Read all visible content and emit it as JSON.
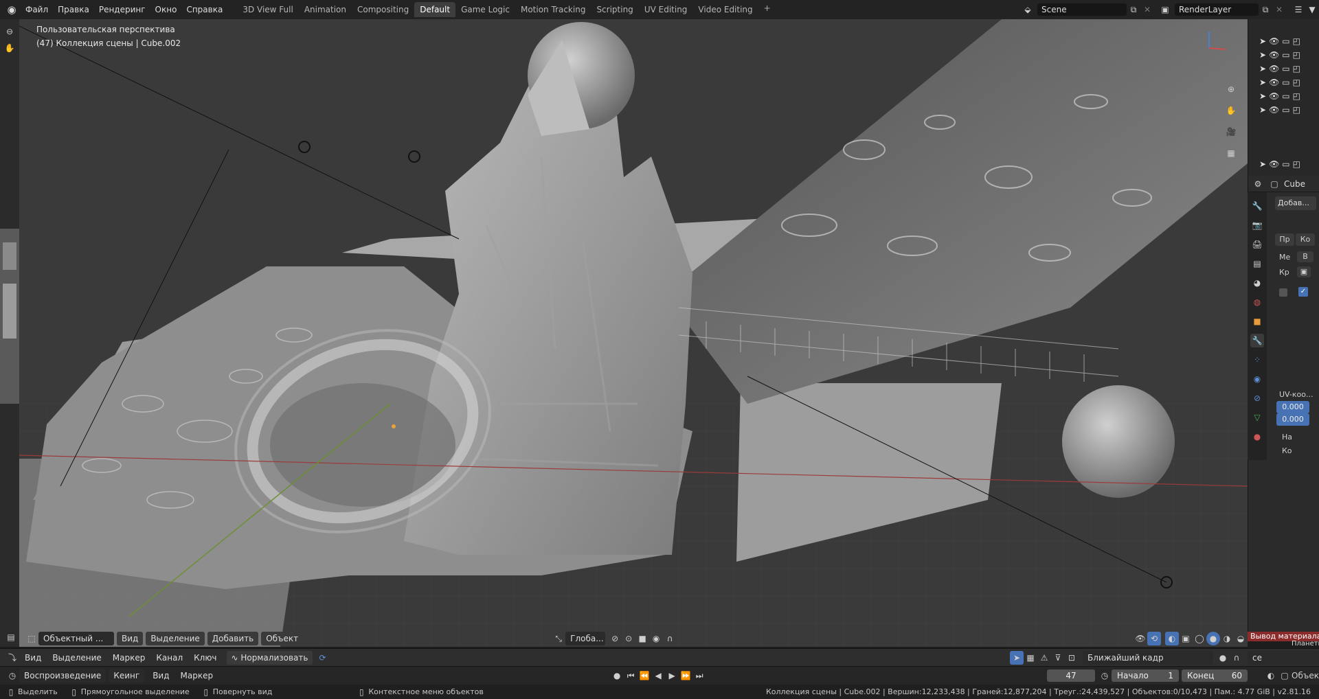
{
  "menu": {
    "items": [
      "Файл",
      "Правка",
      "Рендеринг",
      "Окно",
      "Справка"
    ]
  },
  "workspaces": {
    "tabs": [
      "3D View Full",
      "Animation",
      "Compositing",
      "Default",
      "Game Logic",
      "Motion Tracking",
      "Scripting",
      "UV Editing",
      "Video Editing"
    ],
    "active": "Default",
    "add_label": "+"
  },
  "scene": {
    "name": "Scene"
  },
  "render_layer": {
    "name": "RenderLayer"
  },
  "viewport": {
    "perspective_label": "Пользовательская перспектива",
    "collection_label": "(47) Коллекция сцены | Cube.002"
  },
  "viewport_header": {
    "mode": "Объектный ...",
    "menus": [
      "Вид",
      "Выделение",
      "Добавить",
      "Объект"
    ],
    "transform_orientation": "Глоба..."
  },
  "properties": {
    "object_name": "Cube",
    "add_modifier": "Добав...",
    "tab_left": "Пр",
    "tab_right": "Ко",
    "me_label": "Ме",
    "b_label": "В",
    "kr_label": "Кр",
    "uv_label": "UV-коо...",
    "uv_x": "0.000",
    "uv_y": "0.000",
    "na_label": "На",
    "ko_label": "Ко",
    "material_output": "Вывод материала",
    "planet_label": "Планеты",
    "ce_label": "се"
  },
  "graph_header": {
    "menus": [
      "Вид",
      "Выделение",
      "Маркер",
      "Канал",
      "Ключ"
    ],
    "normalize": "Нормализовать",
    "nearest_frame": "Ближайший кадр"
  },
  "timeline": {
    "playback": "Воспроизведение",
    "keying": "Кеинг",
    "view": "Вид",
    "marker": "Маркер",
    "current_frame": "47",
    "start_label": "Начало",
    "start": "1",
    "end_label": "Конец",
    "end": "60",
    "object_label": "Объект"
  },
  "status": {
    "select": "Выделить",
    "box_select": "Прямоугольное выделение",
    "rotate_view": "Повернуть вид",
    "context_menu": "Контекстное меню объектов",
    "stats": "Коллекция сцены | Cube.002 | Вершин:12,233,438 | Граней:12,877,204 | Треуг.:24,439,527 | Объектов:0/10,473 | Пам.: 4.77 GiB | v2.81.16"
  },
  "colors": {
    "accent": "#4772b3",
    "viewport_bg": "#3c3c3c",
    "red_button": "#8c2b2b"
  }
}
